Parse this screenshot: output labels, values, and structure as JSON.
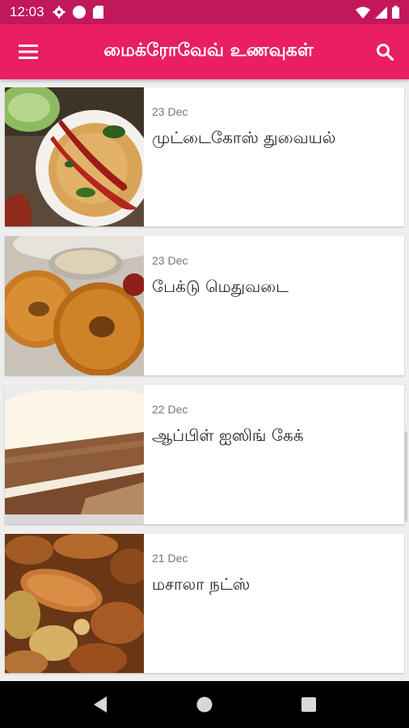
{
  "status_bar": {
    "time": "12:03",
    "left_icons": [
      "gear-icon",
      "circle-icon",
      "sd-card-icon"
    ],
    "right_icons": [
      "wifi-icon",
      "signal-icon",
      "battery-icon"
    ]
  },
  "app_bar": {
    "title": "மைக்ரோவேவ் உணவுகள்",
    "color": "#e91e63",
    "status_color": "#c2185b"
  },
  "recipes": [
    {
      "date": "23 Dec",
      "title": "முட்டைகோஸ் துவையல்"
    },
    {
      "date": "23 Dec",
      "title": "பேக்டு மெதுவடை"
    },
    {
      "date": "22 Dec",
      "title": "ஆப்பிள் ஐஸிங் கேக்"
    },
    {
      "date": "21 Dec",
      "title": "மசாலா நட்ஸ்"
    }
  ],
  "nav_bar": [
    "back-icon",
    "home-icon",
    "recents-icon"
  ]
}
